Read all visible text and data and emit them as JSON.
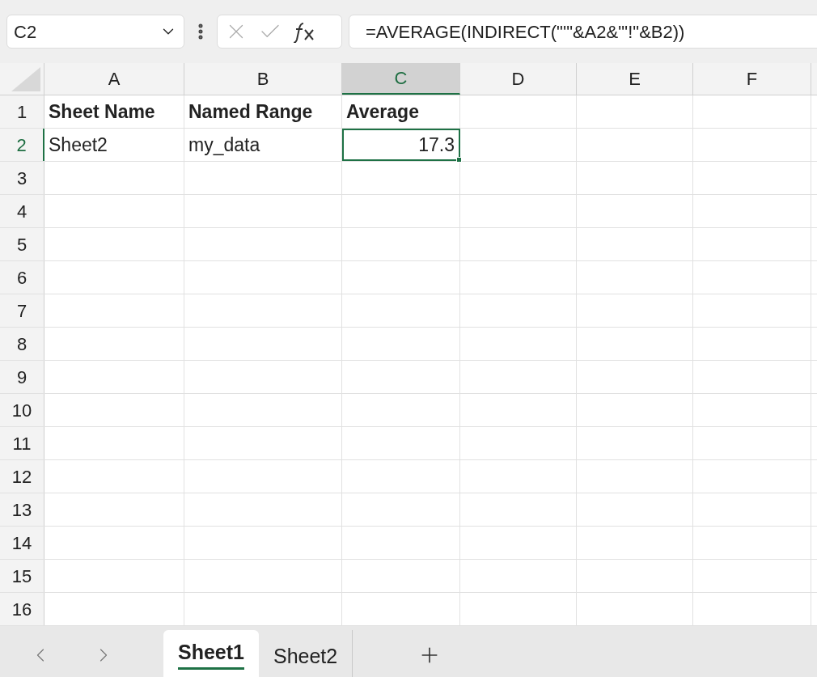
{
  "name_box": "C2",
  "formula": "=AVERAGE(INDIRECT(\"'\"&A2&\"'!\"&B2))",
  "columns": [
    {
      "label": "A",
      "selected": false
    },
    {
      "label": "B",
      "selected": false
    },
    {
      "label": "C",
      "selected": true
    },
    {
      "label": "D",
      "selected": false
    },
    {
      "label": "E",
      "selected": false
    },
    {
      "label": "F",
      "selected": false
    }
  ],
  "rows": [
    {
      "label": "1",
      "selected": false,
      "cells": [
        {
          "text": "Sheet Name",
          "bold": true,
          "kind": "text",
          "selected": false
        },
        {
          "text": "Named Range",
          "bold": true,
          "kind": "text",
          "selected": false
        },
        {
          "text": "Average",
          "bold": true,
          "kind": "text",
          "selected": false
        }
      ]
    },
    {
      "label": "2",
      "selected": true,
      "cells": [
        {
          "text": "Sheet2",
          "bold": false,
          "kind": "text",
          "selected": false
        },
        {
          "text": "my_data",
          "bold": false,
          "kind": "text",
          "selected": false
        },
        {
          "text": "17.3",
          "bold": false,
          "kind": "number",
          "selected": true
        }
      ]
    },
    {
      "label": "3",
      "selected": false
    },
    {
      "label": "4",
      "selected": false
    },
    {
      "label": "5",
      "selected": false
    },
    {
      "label": "6",
      "selected": false
    },
    {
      "label": "7",
      "selected": false
    },
    {
      "label": "8",
      "selected": false
    },
    {
      "label": "9",
      "selected": false
    },
    {
      "label": "10",
      "selected": false
    },
    {
      "label": "11",
      "selected": false
    },
    {
      "label": "12",
      "selected": false
    },
    {
      "label": "13",
      "selected": false
    },
    {
      "label": "14",
      "selected": false
    },
    {
      "label": "15",
      "selected": false
    },
    {
      "label": "16",
      "selected": false
    }
  ],
  "sheet_tabs": [
    {
      "label": "Sheet1",
      "selected": true
    },
    {
      "label": "Sheet2",
      "selected": false
    }
  ]
}
